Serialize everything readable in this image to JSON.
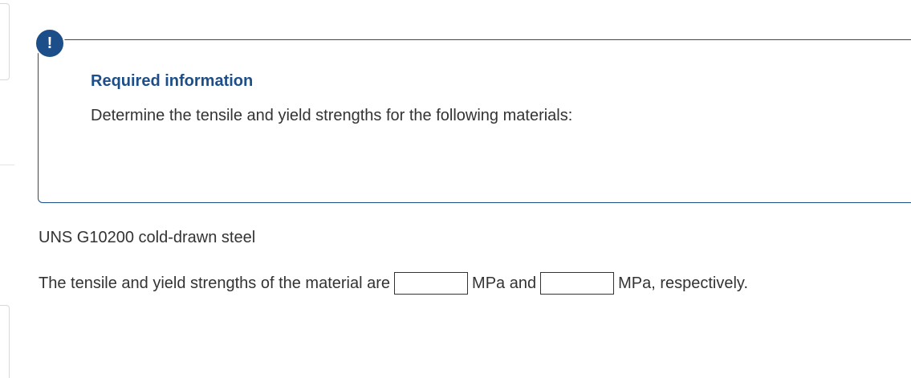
{
  "alert": {
    "symbol": "!",
    "color": "#1c4f89"
  },
  "info": {
    "title": "Required information",
    "text": "Determine the tensile and yield strengths for the following materials:"
  },
  "question": {
    "material": "UNS G10200 cold-drawn steel",
    "prefix": "The tensile and yield strengths of the material are",
    "tensile_value": "",
    "middle": "MPa and",
    "yield_value": "",
    "suffix": "MPa, respectively."
  }
}
